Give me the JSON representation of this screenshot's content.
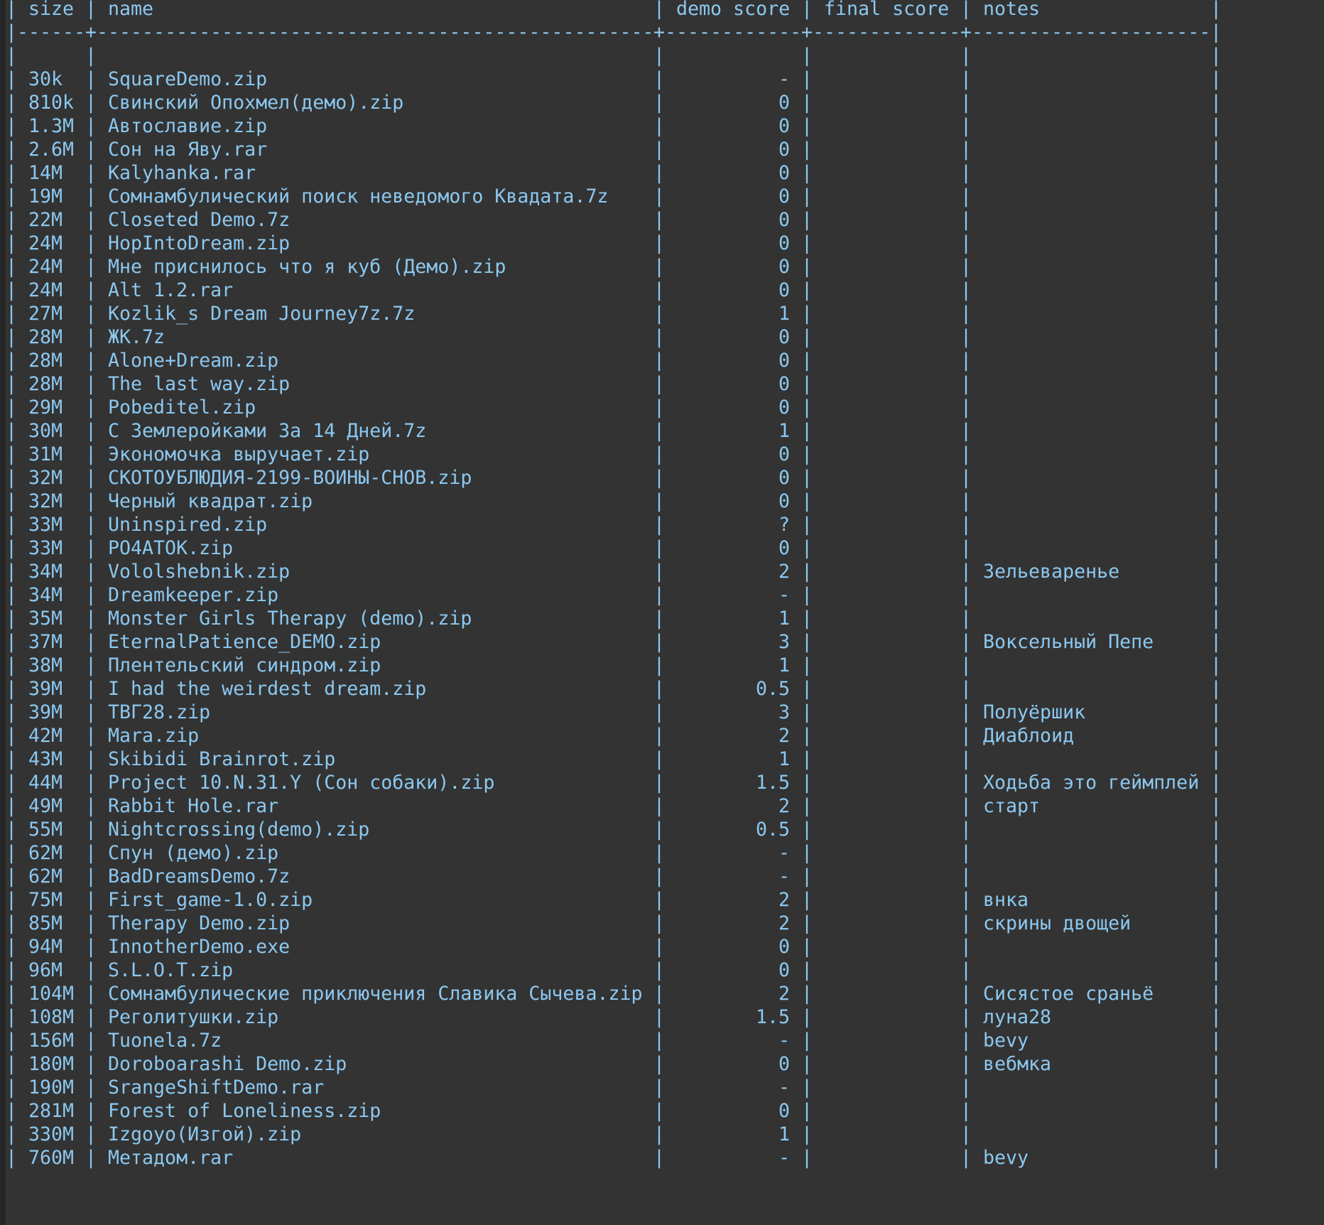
{
  "header": {
    "size": "size",
    "name": "name",
    "demo": "demo score",
    "final": "final score",
    "notes": "notes"
  },
  "rows": [
    {
      "size": "30k",
      "name": "SquareDemo.zip",
      "demo": "-",
      "final": "",
      "notes": ""
    },
    {
      "size": "810k",
      "name": "Свинский Опохмел(демо).zip",
      "demo": "0",
      "final": "",
      "notes": ""
    },
    {
      "size": "1.3M",
      "name": "Автославие.zip",
      "demo": "0",
      "final": "",
      "notes": ""
    },
    {
      "size": "2.6M",
      "name": "Сон на Яву.rar",
      "demo": "0",
      "final": "",
      "notes": ""
    },
    {
      "size": "14M",
      "name": "Kalyhanka.rar",
      "demo": "0",
      "final": "",
      "notes": ""
    },
    {
      "size": "19M",
      "name": "Сомнамбулический поиск неведомого Квадата.7z",
      "demo": "0",
      "final": "",
      "notes": ""
    },
    {
      "size": "22M",
      "name": "Closeted Demo.7z",
      "demo": "0",
      "final": "",
      "notes": ""
    },
    {
      "size": "24M",
      "name": "HopIntoDream.zip",
      "demo": "0",
      "final": "",
      "notes": ""
    },
    {
      "size": "24M",
      "name": "Мне приснилось что я куб (Демо).zip",
      "demo": "0",
      "final": "",
      "notes": ""
    },
    {
      "size": "24M",
      "name": "Alt 1.2.rar",
      "demo": "0",
      "final": "",
      "notes": ""
    },
    {
      "size": "27M",
      "name": "Kozlik_s Dream Journey7z.7z",
      "demo": "1",
      "final": "",
      "notes": ""
    },
    {
      "size": "28M",
      "name": "ЖК.7z",
      "demo": "0",
      "final": "",
      "notes": ""
    },
    {
      "size": "28M",
      "name": "Alone+Dream.zip",
      "demo": "0",
      "final": "",
      "notes": ""
    },
    {
      "size": "28M",
      "name": "The last way.zip",
      "demo": "0",
      "final": "",
      "notes": ""
    },
    {
      "size": "29M",
      "name": "Pobeditel.zip",
      "demo": "0",
      "final": "",
      "notes": ""
    },
    {
      "size": "30M",
      "name": "С Землеройками За 14 Дней.7z",
      "demo": "1",
      "final": "",
      "notes": ""
    },
    {
      "size": "31M",
      "name": "Экономочка выручает.zip",
      "demo": "0",
      "final": "",
      "notes": ""
    },
    {
      "size": "32M",
      "name": "СКОТОУБЛЮДИЯ-2199-ВОИНЫ-СНОВ.zip",
      "demo": "0",
      "final": "",
      "notes": ""
    },
    {
      "size": "32M",
      "name": "Черный квадрат.zip",
      "demo": "0",
      "final": "",
      "notes": ""
    },
    {
      "size": "33M",
      "name": "Uninspired.zip",
      "demo": "?",
      "final": "",
      "notes": ""
    },
    {
      "size": "33M",
      "name": "PO4ATOK.zip",
      "demo": "0",
      "final": "",
      "notes": ""
    },
    {
      "size": "34M",
      "name": "Vololshebnik.zip",
      "demo": "2",
      "final": "",
      "notes": "Зельеваренье"
    },
    {
      "size": "34M",
      "name": "Dreamkeeper.zip",
      "demo": "-",
      "final": "",
      "notes": ""
    },
    {
      "size": "35M",
      "name": "Monster Girls Therapy (demo).zip",
      "demo": "1",
      "final": "",
      "notes": ""
    },
    {
      "size": "37M",
      "name": "EternalPatience_DEMO.zip",
      "demo": "3",
      "final": "",
      "notes": "Воксельный Пепе"
    },
    {
      "size": "38M",
      "name": "Плентельский синдром.zip",
      "demo": "1",
      "final": "",
      "notes": ""
    },
    {
      "size": "39M",
      "name": "I had the weirdest dream.zip",
      "demo": "0.5",
      "final": "",
      "notes": ""
    },
    {
      "size": "39M",
      "name": "ТВГ28.zip",
      "demo": "3",
      "final": "",
      "notes": "Полуёршик"
    },
    {
      "size": "42M",
      "name": "Mara.zip",
      "demo": "2",
      "final": "",
      "notes": "Диаблоид"
    },
    {
      "size": "43M",
      "name": "Skibidi Brainrot.zip",
      "demo": "1",
      "final": "",
      "notes": ""
    },
    {
      "size": "44M",
      "name": "Project 10.N.31.Y (Сон собаки).zip",
      "demo": "1.5",
      "final": "",
      "notes": "Ходьба это геймплей"
    },
    {
      "size": "49M",
      "name": "Rabbit Hole.rar",
      "demo": "2",
      "final": "",
      "notes": "старт"
    },
    {
      "size": "55M",
      "name": "Nightcrossing(demo).zip",
      "demo": "0.5",
      "final": "",
      "notes": ""
    },
    {
      "size": "62M",
      "name": "Спун (демо).zip",
      "demo": "-",
      "final": "",
      "notes": ""
    },
    {
      "size": "62M",
      "name": "BadDreamsDemo.7z",
      "demo": "-",
      "final": "",
      "notes": ""
    },
    {
      "size": "75M",
      "name": "First_game-1.0.zip",
      "demo": "2",
      "final": "",
      "notes": "внка"
    },
    {
      "size": "85M",
      "name": "Therapy Demo.zip",
      "demo": "2",
      "final": "",
      "notes": "скрины двощей"
    },
    {
      "size": "94M",
      "name": "InnotherDemo.exe",
      "demo": "0",
      "final": "",
      "notes": ""
    },
    {
      "size": "96M",
      "name": "S.L.O.T.zip",
      "demo": "0",
      "final": "",
      "notes": ""
    },
    {
      "size": "104M",
      "name": "Сомнамбулические приключения Славика Сычева.zip",
      "demo": "2",
      "final": "",
      "notes": "Сисястое сраньё"
    },
    {
      "size": "108M",
      "name": "Реголитушки.zip",
      "demo": "1.5",
      "final": "",
      "notes": "луна28"
    },
    {
      "size": "156M",
      "name": "Tuonela.7z",
      "demo": "-",
      "final": "",
      "notes": "bevy"
    },
    {
      "size": "180M",
      "name": "Doroboarashi Demo.zip",
      "demo": "0",
      "final": "",
      "notes": "вебмка"
    },
    {
      "size": "190M",
      "name": "SrangeShiftDemo.rar",
      "demo": "-",
      "final": "",
      "notes": ""
    },
    {
      "size": "281M",
      "name": "Forest of Loneliness.zip",
      "demo": "0",
      "final": "",
      "notes": ""
    },
    {
      "size": "330M",
      "name": "Izgoyo(Изгой).zip",
      "demo": "1",
      "final": "",
      "notes": ""
    },
    {
      "size": "760M",
      "name": "Метадом.rar",
      "demo": "-",
      "final": "",
      "notes": "bevy"
    }
  ]
}
